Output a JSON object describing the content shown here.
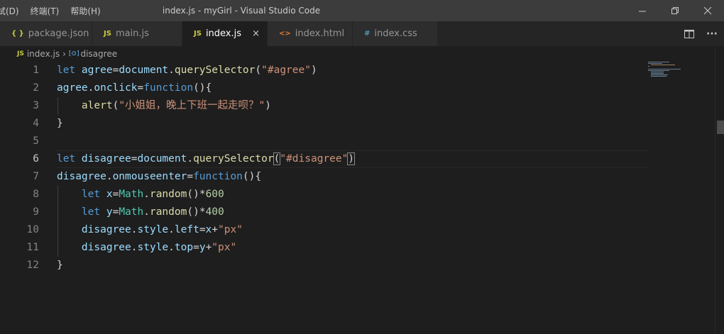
{
  "menu": {
    "items": [
      "试(D)",
      "终端(T)",
      "帮助(H)"
    ]
  },
  "window": {
    "title": "index.js - myGirl - Visual Studio Code",
    "minimize_icon": "minimize-icon",
    "restore_icon": "restore-icon",
    "close_icon": "close-icon"
  },
  "tabs": [
    {
      "icon_text": "{ }",
      "icon_color": "#cbcb41",
      "label": "package.json",
      "active": false
    },
    {
      "icon_text": "JS",
      "icon_color": "#cbcb41",
      "label": "main.js",
      "active": false
    },
    {
      "icon_text": "JS",
      "icon_color": "#cbcb41",
      "label": "index.js",
      "active": true,
      "close": "×"
    },
    {
      "icon_text": "<>",
      "icon_color": "#e37933",
      "label": "index.html",
      "active": false
    },
    {
      "icon_text": "#",
      "icon_color": "#519aba",
      "label": "index.css",
      "active": false
    }
  ],
  "tab_actions": {
    "split_icon": "split-editor-icon",
    "more": "···"
  },
  "breadcrumb": {
    "file_icon_text": "JS",
    "file": "index.js",
    "separator": "›",
    "symbol_icon_text": "[⊙]",
    "symbol": "disagree"
  },
  "editor": {
    "current_line": 6,
    "lines": [
      {
        "n": "1",
        "tokens": [
          [
            "kw",
            "let "
          ],
          [
            "var",
            "agree"
          ],
          [
            "op",
            "="
          ],
          [
            "var",
            "document"
          ],
          [
            "op",
            "."
          ],
          [
            "fn",
            "querySelector"
          ],
          [
            "op",
            "("
          ],
          [
            "str",
            "\"#agree\""
          ],
          [
            "op",
            ")"
          ]
        ]
      },
      {
        "n": "2",
        "tokens": [
          [
            "var",
            "agree"
          ],
          [
            "op",
            "."
          ],
          [
            "var",
            "onclick"
          ],
          [
            "op",
            "="
          ],
          [
            "kw",
            "function"
          ],
          [
            "op",
            "(){"
          ]
        ]
      },
      {
        "n": "3",
        "tokens": [
          [
            "op",
            "    "
          ],
          [
            "fn",
            "alert"
          ],
          [
            "op",
            "("
          ],
          [
            "str",
            "\"小姐姐，晚上下班一起走呗？\""
          ],
          [
            "op",
            ")"
          ]
        ]
      },
      {
        "n": "4",
        "tokens": [
          [
            "op",
            "}"
          ]
        ]
      },
      {
        "n": "5",
        "tokens": []
      },
      {
        "n": "6",
        "tokens": [
          [
            "kw",
            "let "
          ],
          [
            "var",
            "disagree"
          ],
          [
            "op",
            "="
          ],
          [
            "var",
            "document"
          ],
          [
            "op",
            "."
          ],
          [
            "fn",
            "querySelector"
          ],
          [
            "op",
            "("
          ],
          [
            "str",
            "\"#disagree\""
          ],
          [
            "op",
            ")"
          ]
        ]
      },
      {
        "n": "7",
        "tokens": [
          [
            "var",
            "disagree"
          ],
          [
            "op",
            "."
          ],
          [
            "var",
            "onmouseenter"
          ],
          [
            "op",
            "="
          ],
          [
            "kw",
            "function"
          ],
          [
            "op",
            "(){"
          ]
        ]
      },
      {
        "n": "8",
        "tokens": [
          [
            "op",
            "    "
          ],
          [
            "kw",
            "let "
          ],
          [
            "var",
            "x"
          ],
          [
            "op",
            "="
          ],
          [
            "cls",
            "Math"
          ],
          [
            "op",
            "."
          ],
          [
            "fn",
            "random"
          ],
          [
            "op",
            "()*"
          ],
          [
            "num",
            "600"
          ]
        ]
      },
      {
        "n": "9",
        "tokens": [
          [
            "op",
            "    "
          ],
          [
            "kw",
            "let "
          ],
          [
            "var",
            "y"
          ],
          [
            "op",
            "="
          ],
          [
            "cls",
            "Math"
          ],
          [
            "op",
            "."
          ],
          [
            "fn",
            "random"
          ],
          [
            "op",
            "()*"
          ],
          [
            "num",
            "400"
          ]
        ]
      },
      {
        "n": "10",
        "tokens": [
          [
            "op",
            "    "
          ],
          [
            "var",
            "disagree"
          ],
          [
            "op",
            "."
          ],
          [
            "var",
            "style"
          ],
          [
            "op",
            "."
          ],
          [
            "var",
            "left"
          ],
          [
            "op",
            "="
          ],
          [
            "var",
            "x"
          ],
          [
            "op",
            "+"
          ],
          [
            "str",
            "\"px\""
          ]
        ]
      },
      {
        "n": "11",
        "tokens": [
          [
            "op",
            "    "
          ],
          [
            "var",
            "disagree"
          ],
          [
            "op",
            "."
          ],
          [
            "var",
            "style"
          ],
          [
            "op",
            "."
          ],
          [
            "var",
            "top"
          ],
          [
            "op",
            "="
          ],
          [
            "var",
            "y"
          ],
          [
            "op",
            "+"
          ],
          [
            "str",
            "\"px\""
          ]
        ]
      },
      {
        "n": "12",
        "tokens": [
          [
            "op",
            "}"
          ]
        ]
      }
    ]
  },
  "colors": {
    "keyword": "#569cd6",
    "variable": "#9cdcfe",
    "function": "#dcdcaa",
    "string": "#ce9178",
    "number": "#b5cea8",
    "class": "#4ec9b0"
  }
}
